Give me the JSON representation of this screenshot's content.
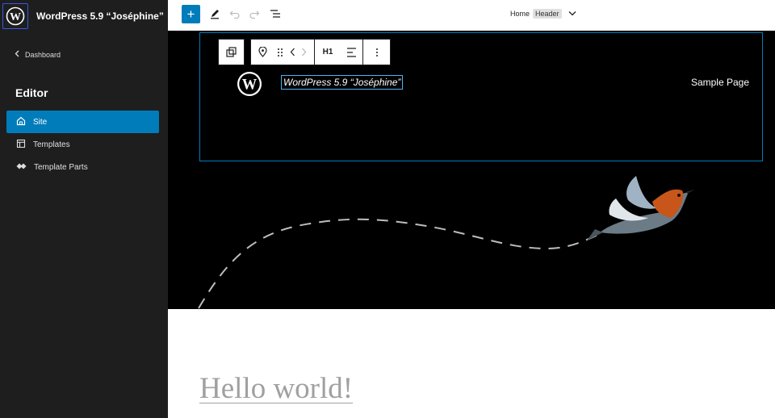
{
  "site_hub": {
    "title": "WordPress 5.9 “Joséphine”",
    "logo_icon": "wordpress-icon"
  },
  "sidebar": {
    "back_label": "Dashboard",
    "heading": "Editor",
    "items": [
      {
        "label": "Site",
        "icon": "home-icon",
        "active": true
      },
      {
        "label": "Templates",
        "icon": "layout-icon",
        "active": false
      },
      {
        "label": "Template Parts",
        "icon": "symbol-filled-icon",
        "active": false
      }
    ]
  },
  "topbar": {
    "add_block": "+",
    "tools": [
      "pencil-icon",
      "undo-icon",
      "redo-icon",
      "list-view-icon"
    ],
    "document_title": "Home",
    "document_badge": "Header",
    "dropdown_icon": "chevron-down-icon"
  },
  "block_toolbar": {
    "heading_level": "H1",
    "tools": [
      "transform-icon",
      "pin-icon",
      "drag-handle-icon",
      "move-left-icon",
      "move-right-icon",
      "align-icon",
      "more-options-icon"
    ]
  },
  "header": {
    "site_title": "WordPress 5.9 “Joséphine”",
    "nav_link": "Sample Page"
  },
  "post": {
    "title": "Hello world!"
  },
  "colors": {
    "accent": "#007cba",
    "sidebar_bg": "#1e1e1e",
    "header_bg": "#000000",
    "selection": "#4ab3f4"
  }
}
